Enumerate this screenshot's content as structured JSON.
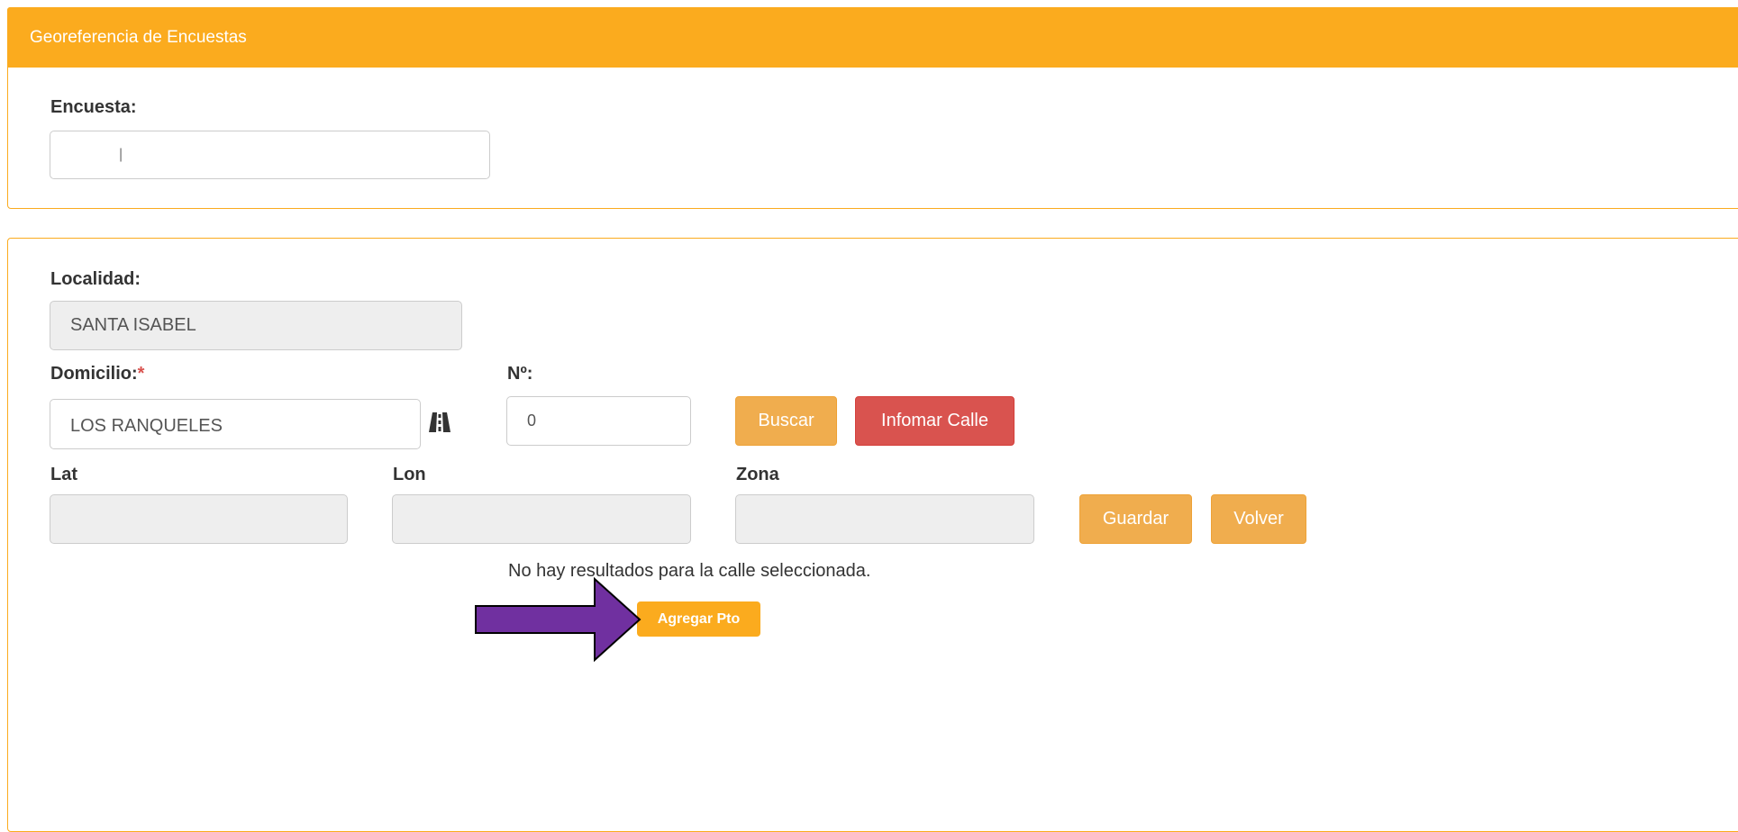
{
  "header": {
    "title": "Georeferencia de Encuestas"
  },
  "encuesta": {
    "label": "Encuesta:",
    "value": "|"
  },
  "localidad": {
    "label": "Localidad:",
    "value": "SANTA ISABEL"
  },
  "domicilio": {
    "label": "Domicilio:",
    "required_mark": "*",
    "value": "LOS RANQUELES",
    "icon": "road-icon"
  },
  "numero": {
    "label": "Nº:",
    "value": "0"
  },
  "buttons": {
    "buscar": "Buscar",
    "informar": "Infomar Calle",
    "guardar": "Guardar",
    "volver": "Volver",
    "agregar": "Agregar Pto"
  },
  "lat": {
    "label": "Lat",
    "value": ""
  },
  "lon": {
    "label": "Lon",
    "value": ""
  },
  "zona": {
    "label": "Zona",
    "value": ""
  },
  "message": "No hay resultados para la calle seleccionada.",
  "colors": {
    "header": "#fbab1e",
    "warning_button": "#f0ad4e",
    "danger_button": "#d9534f",
    "annotation_arrow": "#7030a0"
  }
}
